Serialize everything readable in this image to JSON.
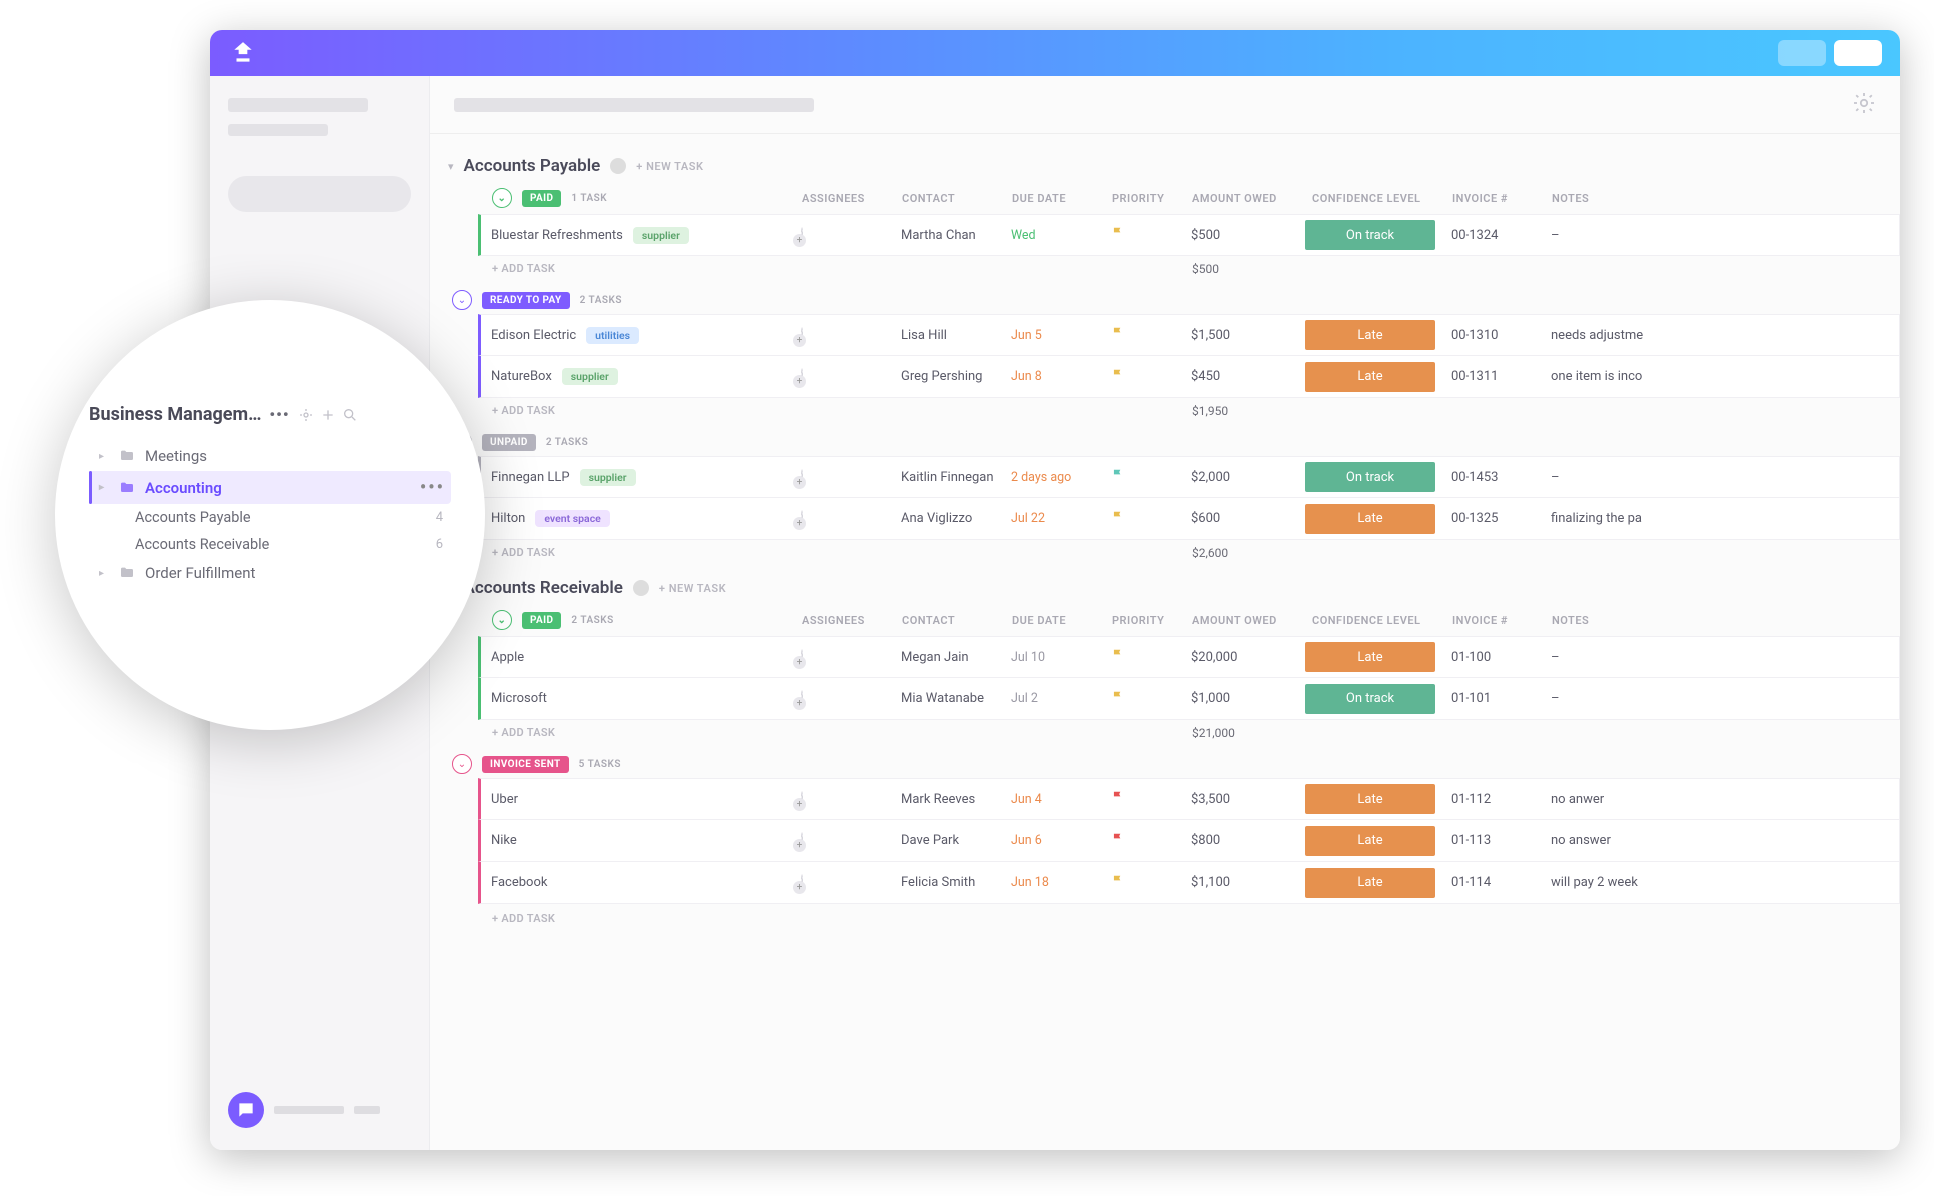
{
  "colors": {
    "paid": "#4bbf73",
    "readypay": "#7e5cff",
    "unpaid": "#b4b3bd",
    "invoicesent": "#e6548b",
    "ontrack": "#5fb594",
    "late": "#e6914e",
    "tag_supplier_bg": "#def2e0",
    "tag_supplier_fg": "#5aa36a",
    "tag_util_bg": "#dbeaff",
    "tag_util_fg": "#4a87d6",
    "tag_event_bg": "#efe3ff",
    "tag_event_fg": "#8a67d8",
    "flag_yellow": "#e9bd4e",
    "flag_teal": "#5fc7b8",
    "flag_red": "#e65252",
    "due_gray": "#9a99a4",
    "due_orange": "#eb8a4c"
  },
  "zoom": {
    "title": "Business Managem…",
    "items": [
      {
        "label": "Meetings",
        "open": false
      },
      {
        "label": "Accounting",
        "open": true,
        "active": true,
        "children": [
          {
            "label": "Accounts Payable",
            "count": "4"
          },
          {
            "label": "Accounts Receivable",
            "count": "6"
          }
        ]
      },
      {
        "label": "Order Fulfillment",
        "open": false
      }
    ]
  },
  "columns": [
    "ASSIGNEES",
    "CONTACT",
    "DUE DATE",
    "PRIORITY",
    "AMOUNT OWED",
    "CONFIDENCE LEVEL",
    "INVOICE #",
    "NOTES"
  ],
  "labels": {
    "newtask": "+ NEW TASK",
    "addtask": "+ ADD TASK"
  },
  "sections": [
    {
      "title": "Accounts Payable",
      "groups": [
        {
          "status": "PAID",
          "status_color_key": "paid",
          "count": "1 TASK",
          "rows": [
            {
              "name": "Bluestar Refreshments",
              "tag": "supplier",
              "tagkey": "supplier",
              "contact": "Martha Chan",
              "due": "Wed",
              "duekey": "paid",
              "flagkey": "flag_yellow",
              "amount": "$500",
              "conf": "On track",
              "confkey": "ontrack",
              "invoice": "00-1324",
              "notes": "–"
            }
          ],
          "subtotal": "$500"
        },
        {
          "status": "READY TO PAY",
          "status_color_key": "readypay",
          "count": "2 TASKS",
          "rows": [
            {
              "name": "Edison Electric",
              "tag": "utilities",
              "tagkey": "util",
              "contact": "Lisa Hill",
              "due": "Jun 5",
              "duekey": "orange",
              "flagkey": "flag_yellow",
              "amount": "$1,500",
              "conf": "Late",
              "confkey": "late",
              "invoice": "00-1310",
              "notes": "needs adjustme"
            },
            {
              "name": "NatureBox",
              "tag": "supplier",
              "tagkey": "supplier",
              "contact": "Greg Pershing",
              "due": "Jun 8",
              "duekey": "orange",
              "flagkey": "flag_yellow",
              "amount": "$450",
              "conf": "Late",
              "confkey": "late",
              "invoice": "00-1311",
              "notes": "one item is inco"
            }
          ],
          "subtotal": "$1,950"
        },
        {
          "status": "UNPAID",
          "status_color_key": "unpaid",
          "count": "2 TASKS",
          "rows": [
            {
              "name": "Finnegan LLP",
              "tag": "supplier",
              "tagkey": "supplier",
              "contact": "Kaitlin Finnegan",
              "due": "2 days ago",
              "duekey": "orange",
              "flagkey": "flag_teal",
              "amount": "$2,000",
              "conf": "On track",
              "confkey": "ontrack",
              "invoice": "00-1453",
              "notes": "–"
            },
            {
              "name": "Hilton",
              "tag": "event space",
              "tagkey": "event",
              "contact": "Ana Viglizzo",
              "due": "Jul 22",
              "duekey": "orange",
              "flagkey": "flag_yellow",
              "amount": "$600",
              "conf": "Late",
              "confkey": "late",
              "invoice": "00-1325",
              "notes": "finalizing the pa"
            }
          ],
          "subtotal": "$2,600"
        }
      ]
    },
    {
      "title": "Accounts Receivable",
      "groups": [
        {
          "status": "PAID",
          "status_color_key": "paid",
          "count": "2 TASKS",
          "rows": [
            {
              "name": "Apple",
              "contact": "Megan Jain",
              "due": "Jul 10",
              "duekey": "gray",
              "flagkey": "flag_yellow",
              "amount": "$20,000",
              "conf": "Late",
              "confkey": "late",
              "invoice": "01-100",
              "notes": "–"
            },
            {
              "name": "Microsoft",
              "contact": "Mia Watanabe",
              "due": "Jul 2",
              "duekey": "gray",
              "flagkey": "flag_yellow",
              "amount": "$1,000",
              "conf": "On track",
              "confkey": "ontrack",
              "invoice": "01-101",
              "notes": "–"
            }
          ],
          "subtotal": "$21,000"
        },
        {
          "status": "INVOICE SENT",
          "status_color_key": "invoicesent",
          "count": "5 TASKS",
          "rows": [
            {
              "name": "Uber",
              "contact": "Mark Reeves",
              "due": "Jun 4",
              "duekey": "orange",
              "flagkey": "flag_red",
              "amount": "$3,500",
              "conf": "Late",
              "confkey": "late",
              "invoice": "01-112",
              "notes": "no anwer"
            },
            {
              "name": "Nike",
              "contact": "Dave Park",
              "due": "Jun 6",
              "duekey": "orange",
              "flagkey": "flag_red",
              "amount": "$800",
              "conf": "Late",
              "confkey": "late",
              "invoice": "01-113",
              "notes": "no answer"
            },
            {
              "name": "Facebook",
              "contact": "Felicia Smith",
              "due": "Jun 18",
              "duekey": "orange",
              "flagkey": "flag_yellow",
              "amount": "$1,100",
              "conf": "Late",
              "confkey": "late",
              "invoice": "01-114",
              "notes": "will pay 2 week"
            }
          ]
        }
      ]
    }
  ]
}
